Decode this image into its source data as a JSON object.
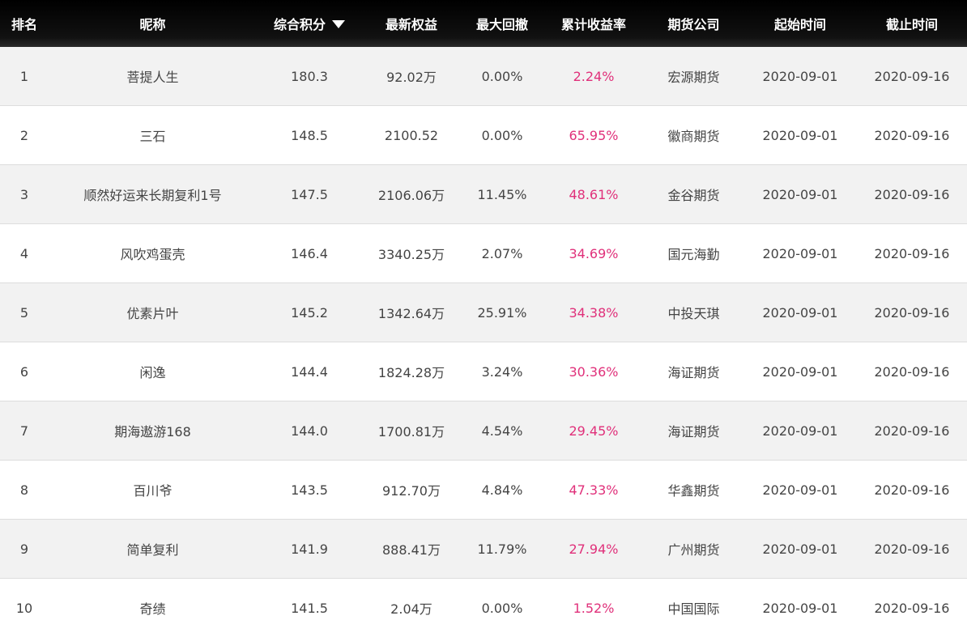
{
  "header": {
    "rank": "排名",
    "nickname": "昵称",
    "score": "综合积分",
    "equity": "最新权益",
    "drawdown": "最大回撤",
    "return": "累计收益率",
    "company": "期货公司",
    "start": "起始时间",
    "end": "截止时间"
  },
  "colors": {
    "header_bg": "#000000",
    "return_color": "#e0307a",
    "odd_row": "#f2f2f2"
  },
  "rows": [
    {
      "rank": "1",
      "nickname": "菩提人生",
      "score": "180.3",
      "equity": "92.02万",
      "drawdown": "0.00%",
      "return": "2.24%",
      "company": "宏源期货",
      "start": "2020-09-01",
      "end": "2020-09-16"
    },
    {
      "rank": "2",
      "nickname": "三石",
      "score": "148.5",
      "equity": "2100.52",
      "drawdown": "0.00%",
      "return": "65.95%",
      "company": "徽商期货",
      "start": "2020-09-01",
      "end": "2020-09-16"
    },
    {
      "rank": "3",
      "nickname": "顺然好运来长期复利1号",
      "score": "147.5",
      "equity": "2106.06万",
      "drawdown": "11.45%",
      "return": "48.61%",
      "company": "金谷期货",
      "start": "2020-09-01",
      "end": "2020-09-16"
    },
    {
      "rank": "4",
      "nickname": "风吹鸡蛋壳",
      "score": "146.4",
      "equity": "3340.25万",
      "drawdown": "2.07%",
      "return": "34.69%",
      "company": "国元海勤",
      "start": "2020-09-01",
      "end": "2020-09-16"
    },
    {
      "rank": "5",
      "nickname": "优素片叶",
      "score": "145.2",
      "equity": "1342.64万",
      "drawdown": "25.91%",
      "return": "34.38%",
      "company": "中投天琪",
      "start": "2020-09-01",
      "end": "2020-09-16"
    },
    {
      "rank": "6",
      "nickname": "闲逸",
      "score": "144.4",
      "equity": "1824.28万",
      "drawdown": "3.24%",
      "return": "30.36%",
      "company": "海证期货",
      "start": "2020-09-01",
      "end": "2020-09-16"
    },
    {
      "rank": "7",
      "nickname": "期海遨游168",
      "score": "144.0",
      "equity": "1700.81万",
      "drawdown": "4.54%",
      "return": "29.45%",
      "company": "海证期货",
      "start": "2020-09-01",
      "end": "2020-09-16"
    },
    {
      "rank": "8",
      "nickname": "百川爷",
      "score": "143.5",
      "equity": "912.70万",
      "drawdown": "4.84%",
      "return": "47.33%",
      "company": "华鑫期货",
      "start": "2020-09-01",
      "end": "2020-09-16"
    },
    {
      "rank": "9",
      "nickname": "简单复利",
      "score": "141.9",
      "equity": "888.41万",
      "drawdown": "11.79%",
      "return": "27.94%",
      "company": "广州期货",
      "start": "2020-09-01",
      "end": "2020-09-16"
    },
    {
      "rank": "10",
      "nickname": "奇绩",
      "score": "141.5",
      "equity": "2.04万",
      "drawdown": "0.00%",
      "return": "1.52%",
      "company": "中国国际",
      "start": "2020-09-01",
      "end": "2020-09-16"
    }
  ]
}
